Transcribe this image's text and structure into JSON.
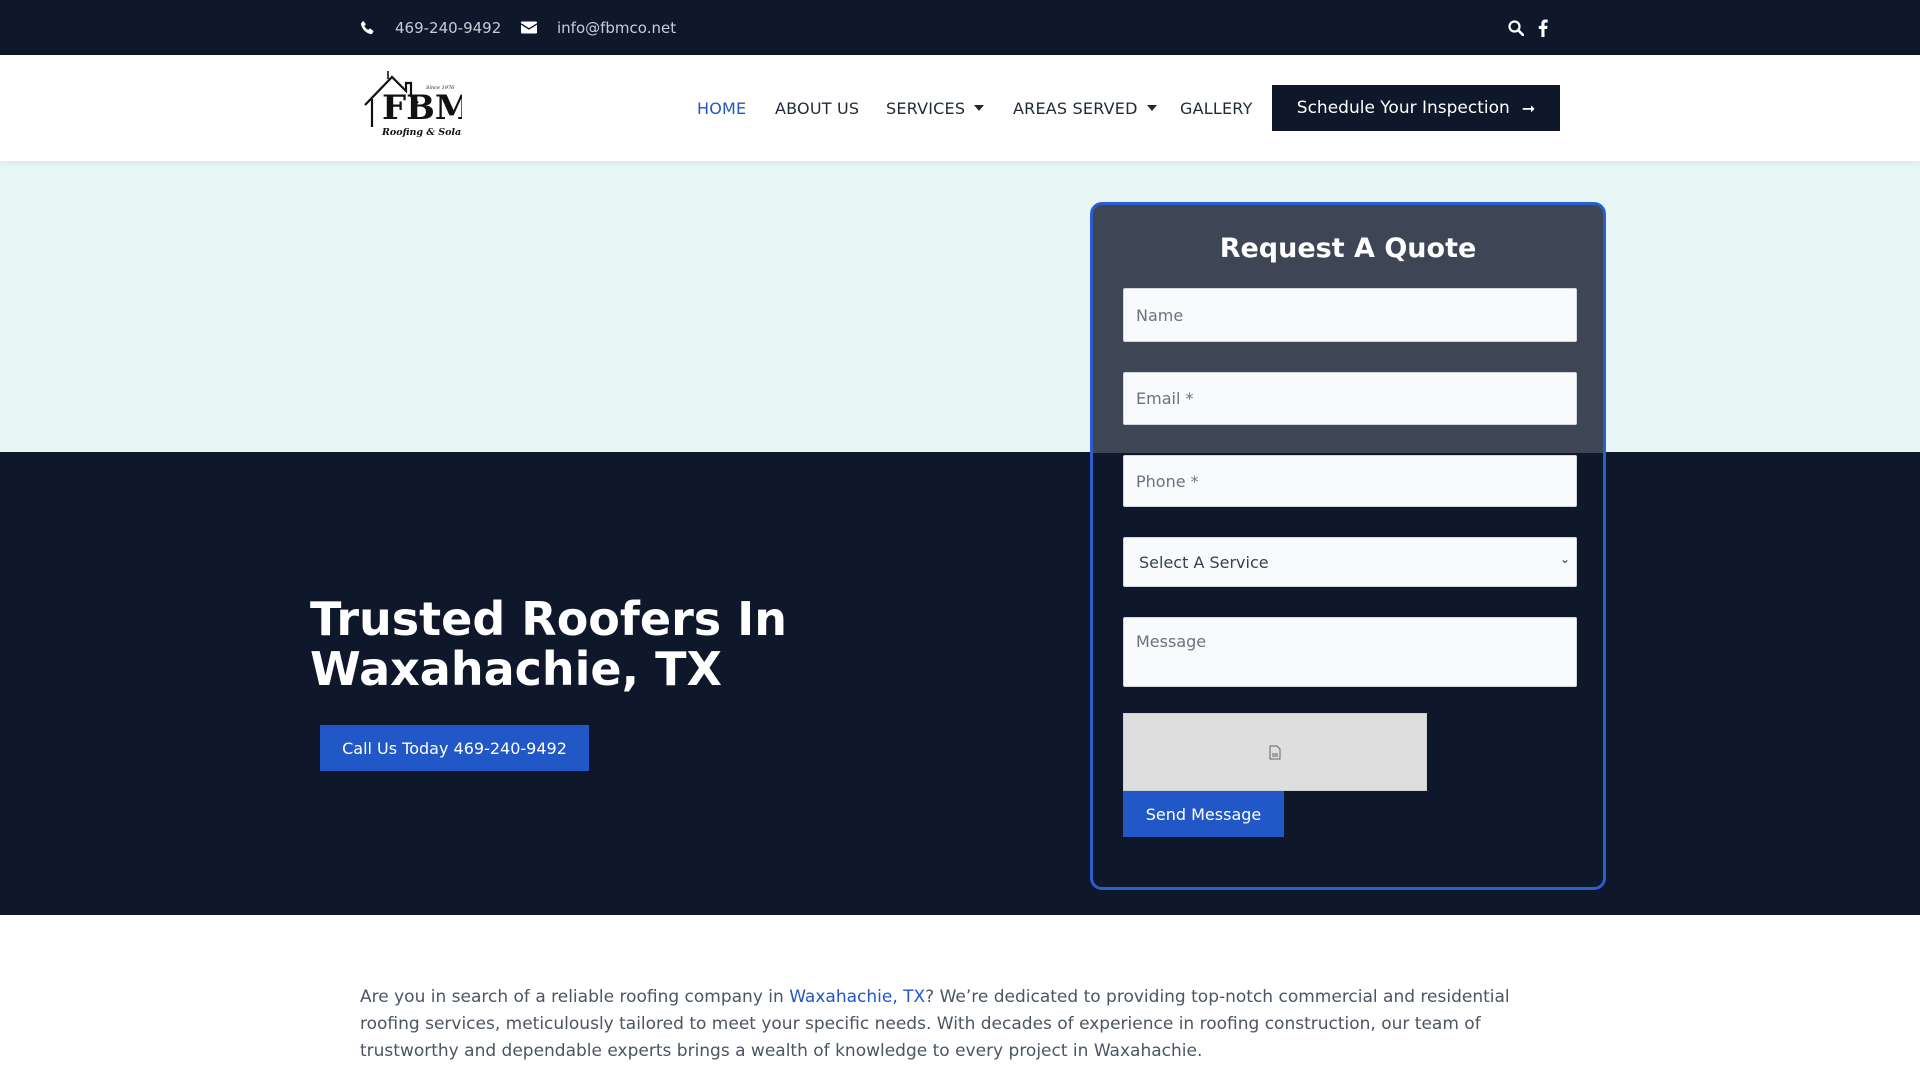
{
  "topbar": {
    "phone": "469-240-9492",
    "email": "info@fbmco.net",
    "icons": [
      "phone-icon",
      "envelope-icon",
      "search-icon",
      "facebook-icon"
    ]
  },
  "header": {
    "logo_alt": "FBM Roofing & Solar",
    "nav": [
      {
        "label": "HOME",
        "active": true
      },
      {
        "label": "ABOUT US"
      },
      {
        "label": "SERVICES",
        "dropdown": true
      },
      {
        "label": "AREAS SERVED",
        "dropdown": true
      },
      {
        "label": "GALLERY"
      }
    ],
    "cta_label": "Schedule Your Inspection"
  },
  "hero": {
    "title": "Trusted Roofers In Waxahachie, TX",
    "call_button": "Call Us Today 469-240-9492"
  },
  "quote_form": {
    "title": "Request A Quote",
    "name_placeholder": "Name",
    "email_placeholder": "Email *",
    "phone_placeholder": "Phone *",
    "service_selected": "Select A Service",
    "message_placeholder": "Message",
    "send_label": "Send Message"
  },
  "intro": {
    "text_before": "Are you in search of a reliable roofing company in ",
    "link_text": "Waxahachie, TX",
    "text_after": "? We’re dedicated to providing top-notch commercial and residential roofing services, meticulously tailored to meet your specific needs. With decades of experience in roofing construction, our team of trustworthy and dependable experts brings a wealth of knowledge to every project in Waxahachie."
  },
  "colors": {
    "navy": "#0f172a",
    "accent_blue": "#2257c8",
    "hero_light": "#e7f6f5",
    "card_gray": "#3e4554"
  }
}
